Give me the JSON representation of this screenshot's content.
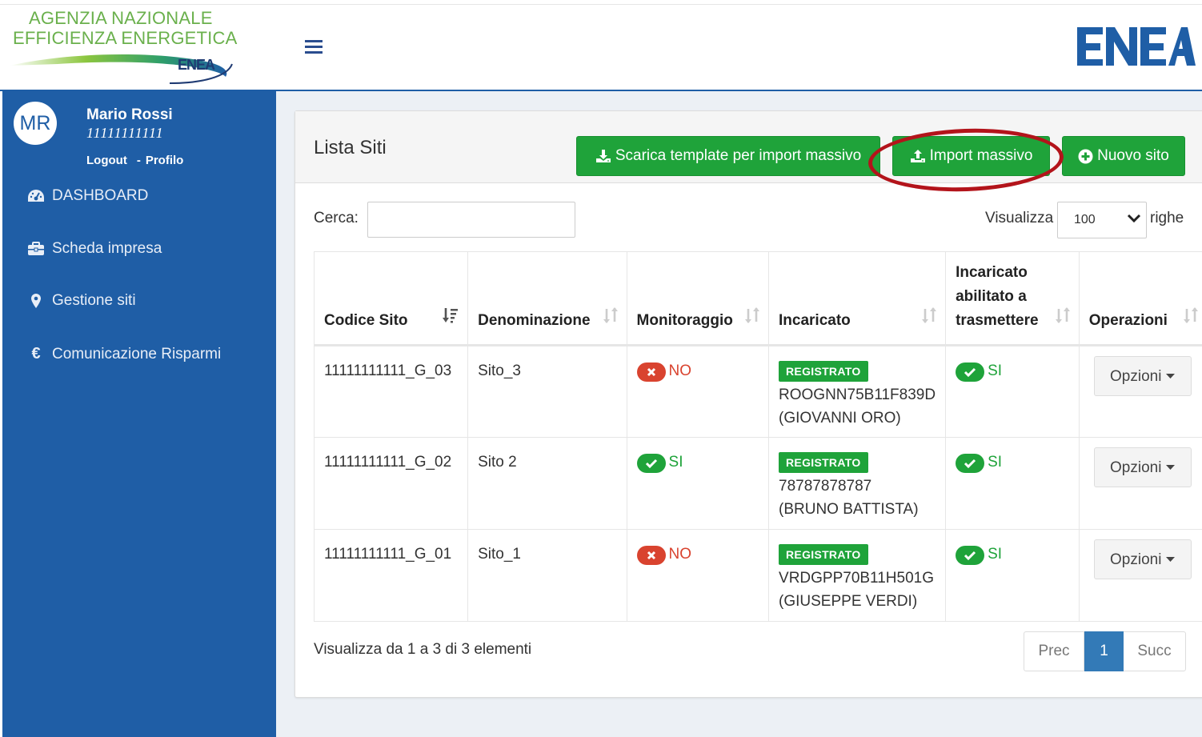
{
  "header": {
    "agency_line1": "AGENZIA NAZIONALE",
    "agency_line2": "EFFICIENZA ENERGETICA",
    "agency_mark": "ENEA",
    "brand_logo": "ENEA",
    "icons": {
      "menu": "hamburger-icon"
    }
  },
  "user": {
    "initials": "MR",
    "name": "Mario Rossi",
    "code": "11111111111",
    "logout_label": "Logout",
    "separator": "-",
    "profile_label": "Profilo"
  },
  "sidebar": {
    "items": [
      {
        "label": "DASHBOARD",
        "icon": "dashboard-icon"
      },
      {
        "label": "Scheda impresa",
        "icon": "briefcase-icon"
      },
      {
        "label": "Gestione siti",
        "icon": "map-marker-icon"
      },
      {
        "label": "Comunicazione Risparmi",
        "icon": "euro-icon"
      }
    ]
  },
  "panel": {
    "title": "Lista Siti",
    "buttons": {
      "template": "Scarica template per import massivo",
      "import": "Import massivo",
      "new_site": "Nuovo sito"
    },
    "search_label": "Cerca:",
    "search_value": "",
    "show_label": "Visualizza",
    "page_size": "100",
    "rows_label": "righe"
  },
  "table": {
    "columns": [
      "Codice Sito",
      "Denominazione",
      "Monitoraggio",
      "Incaricato",
      "Incaricato abilitato a trasmettere",
      "Operazioni"
    ],
    "rows": [
      {
        "code": "11111111111_G_03",
        "name": "Sito_3",
        "monitor": "NO",
        "status": "REGISTRATO",
        "assignee_id": "ROOGNN75B11F839D",
        "assignee_name": "(GIOVANNI ORO)",
        "enabled": "SI",
        "ops": "Opzioni"
      },
      {
        "code": "11111111111_G_02",
        "name": "Sito 2",
        "monitor": "SI",
        "status": "REGISTRATO",
        "assignee_id": "78787878787",
        "assignee_name": "(BRUNO BATTISTA)",
        "enabled": "SI",
        "ops": "Opzioni"
      },
      {
        "code": "11111111111_G_01",
        "name": "Sito_1",
        "monitor": "NO",
        "status": "REGISTRATO",
        "assignee_id": "VRDGPP70B11H501G",
        "assignee_name": "(GIUSEPPE VERDI)",
        "enabled": "SI",
        "ops": "Opzioni"
      }
    ]
  },
  "footer": {
    "info": "Visualizza da 1 a 3 di 3 elementi",
    "prev": "Prec",
    "current_page": "1",
    "next": "Succ"
  },
  "colors": {
    "sidebar": "#1f5ea6",
    "success": "#1fa33a",
    "danger": "#d9432f",
    "highlight": "#b3141b",
    "pager_active": "#337ab7"
  }
}
